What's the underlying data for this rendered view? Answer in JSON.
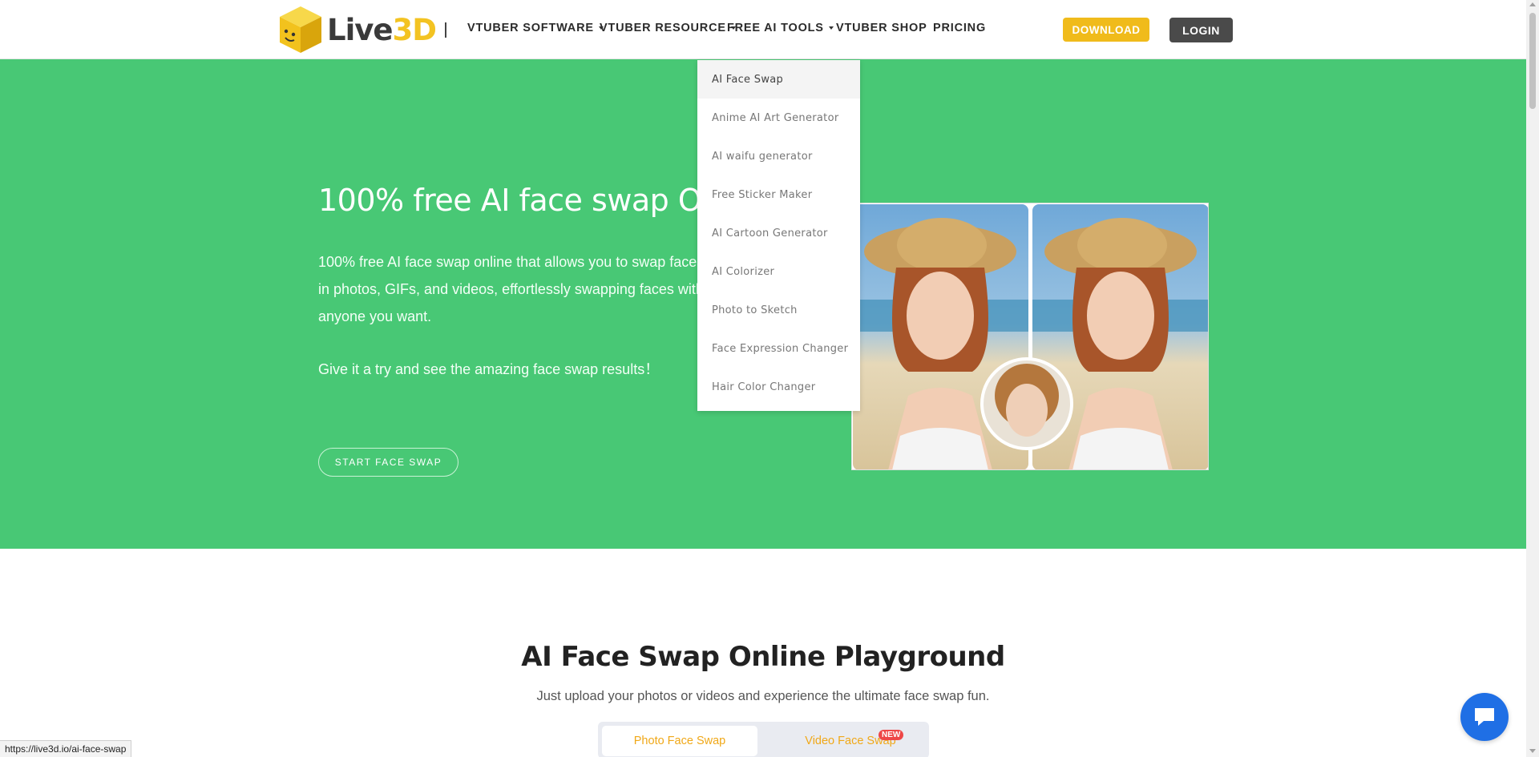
{
  "brand": {
    "logo_text_prefix": "Live",
    "logo_text_accent": "3D",
    "accent_color": "#f3c322"
  },
  "nav": {
    "items": [
      {
        "label": "VTUBER SOFTWARE",
        "has_caret": true
      },
      {
        "label": "VTUBER RESOURCE",
        "has_caret": true
      },
      {
        "label": "FREE AI TOOLS",
        "has_caret": true
      },
      {
        "label": "VTUBER SHOP",
        "has_caret": false
      },
      {
        "label": "PRICING",
        "has_caret": false
      }
    ],
    "download_label": "DOWNLOAD",
    "login_label": "LOGIN"
  },
  "dropdown": {
    "items": [
      "AI Face Swap",
      "Anime AI Art Generator",
      "AI waifu generator",
      "Free Sticker Maker",
      "AI Cartoon Generator",
      "AI Colorizer",
      "Photo to Sketch",
      "Face Expression Changer",
      "Hair Color Changer"
    ],
    "active_item": "AI Face Swap"
  },
  "hero": {
    "title": "100% free AI face swap Online",
    "description": "100% free AI face swap online that allows you to swap faces in photos, GIFs, and videos, effortlessly swapping faces with anyone you want.",
    "subtext": "Give it a try and see the amazing face swap results！",
    "cta_label": "START FACE SWAP",
    "bg_color": "#48c875"
  },
  "playground": {
    "title": "AI Face Swap Online Playground",
    "subtitle": "Just upload your photos or videos and experience the ultimate face swap fun.",
    "tabs": [
      {
        "label": "Photo Face Swap",
        "active": true
      },
      {
        "label": "Video Face Swap",
        "active": false
      }
    ],
    "new_badge": "NEW"
  },
  "status_bar": {
    "url": "https://live3d.io/ai-face-swap"
  },
  "icons": {
    "chat": "chat-bubble-icon",
    "logo": "cube-logo-icon"
  }
}
